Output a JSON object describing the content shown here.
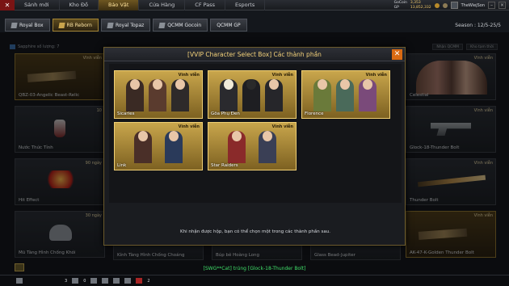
{
  "topbar": {
    "logo": "✕",
    "nav": [
      "Sảnh mới",
      "Kho Đồ",
      "Bảo Vật",
      "Cửa Hàng",
      "CF Pass",
      "Esports"
    ],
    "active_index": 2,
    "currencies": [
      {
        "label": "GoCoin",
        "value": "3,353"
      },
      {
        "label": "GP",
        "value": "13,852,332"
      }
    ],
    "username": "TheWiejSon",
    "window_minimize": "–",
    "window_close": "×"
  },
  "tabs": [
    {
      "label": "Royal Box",
      "active": false
    },
    {
      "label": "RB Reborn",
      "active": true
    },
    {
      "label": "Royal Topaz",
      "active": false
    },
    {
      "label": "QCMM Gocoin",
      "active": false
    },
    {
      "label": "QCMM GP",
      "active": false
    }
  ],
  "season": "Season : 12/5-25/5",
  "grid_header": "Sapphire số lượng: 7",
  "filters": [
    "Nhận QCMM",
    "Kho tạm thời"
  ],
  "cards": [
    {
      "name": "QBZ-03-Angelic Beast-Relic",
      "tag": "Vĩnh viễn",
      "art": "gun",
      "gold": true
    },
    {
      "name": "Nước Thức Tỉnh",
      "tag": "10",
      "art": "potion",
      "gold": false
    },
    {
      "name": "Hit Effect",
      "tag": "90 ngày",
      "art": "effect",
      "gold": false
    },
    {
      "name": "Mũ Tàng Hình Chống Khói",
      "tag": "30 ngày",
      "art": "helmet",
      "gold": false
    },
    {
      "name": "Celestial",
      "tag": "Vĩnh viễn",
      "art": "girls",
      "gold": false
    },
    {
      "name": "Glock-18-Thunder Bolt",
      "tag": "Vĩnh viễn",
      "art": "pistol",
      "gold": false
    },
    {
      "name": "Thunder Bolt",
      "tag": "Vĩnh viễn",
      "art": "blade",
      "gold": false
    },
    {
      "name": "AK-47-K-Golden Thunder Bolt",
      "tag": "Vĩnh viễn",
      "art": "gun",
      "gold": true
    }
  ],
  "bottom_labels": [
    "Kính Tàng Hình Chống Choáng",
    "Búp bê Hoàng Long",
    "Glass Bead-Jupiter"
  ],
  "modal": {
    "title": "[VVIP Character Select Box] Các thành phần",
    "close": "✕",
    "note": "Khi nhận được hộp, bạn có thể chọn một trong các thành phần sau.",
    "characters": [
      {
        "name": "Sicaries",
        "tag": "Vĩnh viễn"
      },
      {
        "name": "Gõa Phụ Đen",
        "tag": "Vĩnh viễn"
      },
      {
        "name": "Florence",
        "tag": "Vĩnh viễn"
      },
      {
        "name": "Link",
        "tag": "Vĩnh viễn"
      },
      {
        "name": "Star Raiders",
        "tag": "Vĩnh viễn"
      }
    ]
  },
  "chat_message": "[SWG**Cat] trúng [Glock-18-Thunder Bolt]",
  "bottombar": {
    "count_a": "3",
    "count_b": "0",
    "count_c": "2"
  },
  "colors": {
    "accent": "#f4d27a",
    "chat_green": "#40e06a",
    "close_orange": "#d96a12"
  }
}
